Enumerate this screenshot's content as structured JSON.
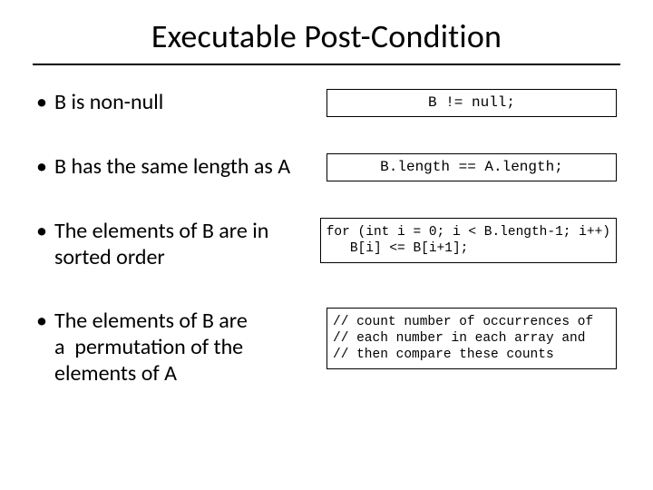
{
  "title": "Executable Post-Condition",
  "rows": [
    {
      "bullet": "•",
      "text": "B is non-null",
      "code": "B != null;"
    },
    {
      "bullet": "•",
      "text": "B has the same length as A",
      "code": "B.length == A.length;"
    },
    {
      "bullet": "•",
      "text": "The elements of B are in sorted order",
      "code": "for (int i = 0; i < B.length-1; i++)\n   B[i] <= B[i+1];"
    },
    {
      "bullet": "•",
      "text": "The elements of B are a  permutation of the elements of A",
      "code": "// count number of occurrences of\n// each number in each array and\n// then compare these counts"
    }
  ]
}
